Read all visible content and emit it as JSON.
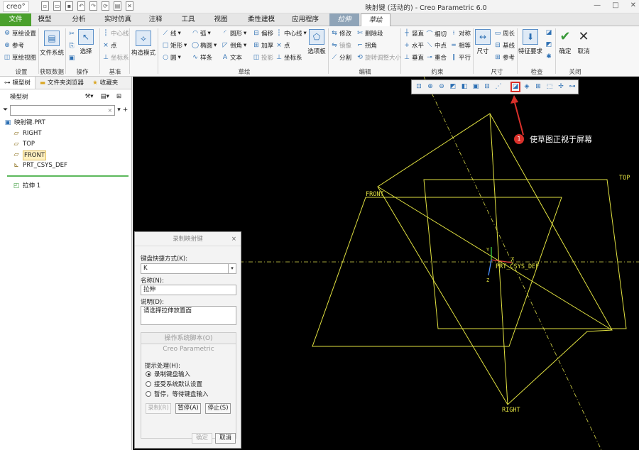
{
  "app": {
    "logo": "creo°",
    "window_title": "映射键 (活动的) - Creo Parametric 6.0",
    "window_controls": [
      "—",
      "□",
      "✕"
    ]
  },
  "tabs": [
    "文件",
    "模型",
    "分析",
    "实时仿真",
    "注释",
    "工具",
    "视图",
    "柔性建模",
    "应用程序",
    "拉伸",
    "草绘"
  ],
  "ribbon": {
    "setup": {
      "items": [
        "草绘设置",
        "参考",
        "草绘视图"
      ],
      "group": "设置"
    },
    "get_data": {
      "label": "文件系统",
      "group": "获取数据"
    },
    "operations": {
      "label": "选择",
      "group": "操作"
    },
    "datum": {
      "items": [
        "中心线",
        "点",
        "坐标系"
      ],
      "group": "基准"
    },
    "construction": {
      "label": "构造模式"
    },
    "sketch": {
      "items": [
        "线",
        "弧",
        "圆形",
        "偏移",
        "中心线",
        "矩形",
        "椭圆",
        "倒角",
        "加厚",
        "点",
        "圆",
        "样条",
        "文本",
        "投影",
        "坐标系"
      ],
      "palette": "选项板",
      "group": "草绘"
    },
    "edit": {
      "items": [
        "修改",
        "删除段",
        "镜像",
        "拐角",
        "分割",
        "旋转调整大小"
      ],
      "group": "编辑"
    },
    "constrain": {
      "items": [
        "竖直",
        "相切",
        "对称",
        "水平",
        "中点",
        "相等",
        "垂直",
        "重合",
        "平行"
      ],
      "group": "约束"
    },
    "dimension": {
      "label": "尺寸",
      "items": [
        "周长",
        "基线",
        "参考"
      ],
      "group": "尺寸"
    },
    "inspect": {
      "label": "特征要求",
      "group": "检查"
    },
    "close": {
      "ok": "确定",
      "cancel": "取消",
      "group": "关闭"
    }
  },
  "left_panel": {
    "tabs": [
      "模型树",
      "文件夹浏览器",
      "收藏夹"
    ],
    "tree_title": "模型树",
    "filter_placeholder": "",
    "items": [
      {
        "label": "映射键.PRT",
        "icon": "part-icon"
      },
      {
        "label": "RIGHT",
        "icon": "datum-plane-icon"
      },
      {
        "label": "TOP",
        "icon": "datum-plane-icon"
      },
      {
        "label": "FRONT",
        "icon": "datum-plane-icon",
        "selected": true
      },
      {
        "label": "PRT_CSYS_DEF",
        "icon": "csys-icon"
      }
    ],
    "feature": "拉伸 1"
  },
  "graphics": {
    "labels": {
      "front": "FRONT",
      "top": "TOP",
      "right": "RIGHT",
      "csys": "PRT_CSYS_DEF",
      "x": "X",
      "y": "Y",
      "z": "Z"
    },
    "callout": {
      "number": "1",
      "text": "使草图正视于屏幕"
    },
    "toolbar_icons": [
      "refit-icon",
      "zoom-in-icon",
      "zoom-out-icon",
      "repaint-icon",
      "saved-views-icon",
      "display-style-icon",
      "view-manager-icon",
      "datum-display-icon",
      "sketch-view-icon",
      "shading-icon",
      "hidden-line-icon",
      "perspective-icon",
      "spin-center-icon",
      "annotation-icon"
    ]
  },
  "dialog": {
    "title": "录制映射键",
    "key_label": "键盘快捷方式(K):",
    "key_value": "K",
    "name_label": "名称(N):",
    "name_value": "拉伸",
    "desc_label": "说明(D):",
    "desc_value": "请选择拉伸放置面",
    "script_tab": "操作系统脚本(O)",
    "script_sub": "Creo Parametric",
    "prompt_label": "提示处理(H):",
    "options": [
      "录制键盘输入",
      "接受系统默认设置",
      "暂停，等待键盘输入"
    ],
    "selected_option": 0,
    "buttons": {
      "record": "录制(R)",
      "pause": "暂停(A)",
      "stop": "停止(S)"
    },
    "ok": "确定",
    "cancel": "取消"
  }
}
